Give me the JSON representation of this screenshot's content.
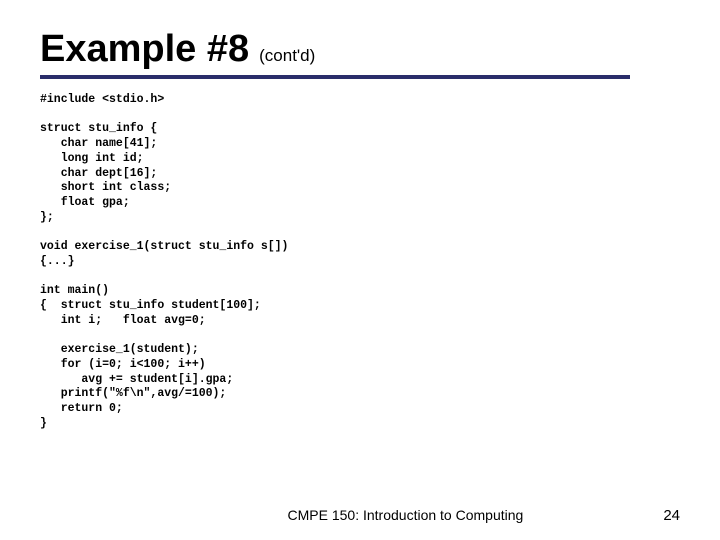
{
  "title": {
    "main": "Example #8",
    "sub": "(cont'd)"
  },
  "code": "#include <stdio.h>\n\nstruct stu_info {\n   char name[41];\n   long int id;\n   char dept[16];\n   short int class;\n   float gpa;\n};\n\nvoid exercise_1(struct stu_info s[])\n{...}\n\nint main()\n{  struct stu_info student[100];\n   int i;   float avg=0;\n\n   exercise_1(student);\n   for (i=0; i<100; i++)\n      avg += student[i].gpa;\n   printf(\"%f\\n\",avg/=100);\n   return 0;\n}",
  "footer": {
    "course": "CMPE 150: Introduction to Computing",
    "page": "24"
  }
}
